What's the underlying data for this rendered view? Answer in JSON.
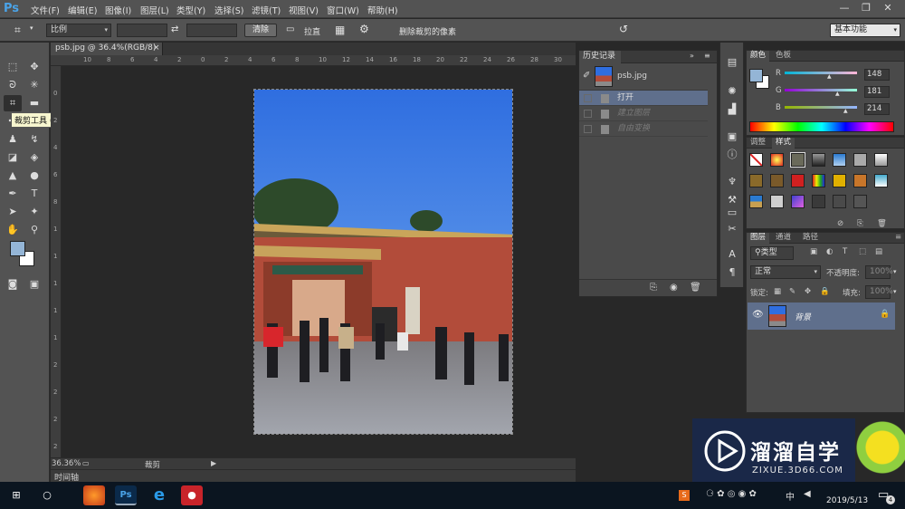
{
  "app": {
    "logo": "Ps"
  },
  "menu": [
    "文件(F)",
    "编辑(E)",
    "图像(I)",
    "图层(L)",
    "类型(Y)",
    "选择(S)",
    "滤镜(T)",
    "视图(V)",
    "窗口(W)",
    "帮助(H)"
  ],
  "options": {
    "ratio": "比例",
    "clear": "清除",
    "straighten": "拉直",
    "delete_cropped": "删除裁剪的像素",
    "workspace": "基本功能"
  },
  "tooltip": "裁剪工具 (C)",
  "document": {
    "tab": "psb.jpg @ 36.4%(RGB/8) *",
    "zoom": "36.36%",
    "status": "裁剪",
    "timeline": "时间轴",
    "hruler": [
      "10",
      "8",
      "6",
      "4",
      "2",
      "0",
      "2",
      "4",
      "6",
      "8",
      "10",
      "12",
      "14",
      "16",
      "18",
      "20",
      "22",
      "24",
      "26",
      "28",
      "30",
      "32"
    ],
    "vruler": [
      "0",
      "2",
      "4",
      "6",
      "8",
      "1",
      "1",
      "1",
      "1",
      "1",
      "2",
      "2",
      "2",
      "2"
    ]
  },
  "history": {
    "title": "历史记录",
    "snapshot": "psb.jpg",
    "items": [
      {
        "label": "打开",
        "state": "selected"
      },
      {
        "label": "建立图层",
        "state": "dim"
      },
      {
        "label": "自由变换",
        "state": "dim"
      }
    ]
  },
  "color_panel": {
    "tabs": [
      "颜色",
      "色板"
    ],
    "r": "148",
    "g": "181",
    "b": "214",
    "r_label": "R",
    "g_label": "G",
    "b_label": "B",
    "fg": "#94b5d6"
  },
  "styles_panel": {
    "tabs": [
      "调整",
      "样式"
    ]
  },
  "layers_panel": {
    "tabs": [
      "图层",
      "通道",
      "路径"
    ],
    "kind": "类型",
    "blend": "正常",
    "opacity_label": "不透明度:",
    "opacity": "100%",
    "lock_label": "锁定:",
    "fill_label": "填充:",
    "fill": "100%",
    "layer_name": "背景"
  },
  "watermark": {
    "title": "溜溜自学",
    "url": "ZIXUE.3D66.COM"
  },
  "taskbar": {
    "time": "2019/5/13",
    "lang": "中",
    "notify": "4"
  }
}
